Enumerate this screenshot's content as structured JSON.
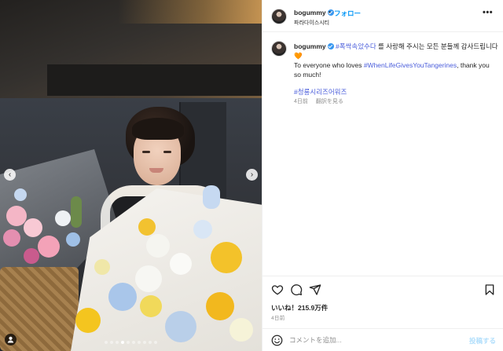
{
  "post": {
    "author": {
      "username": "bogummy",
      "verified": true,
      "location": "파라다이스시티",
      "follow_label": "フォロー",
      "separator": "•"
    },
    "caption": {
      "hashtag1": "#폭싹속았수다",
      "text_ko_after": " 를 사랑해 주시는 모든 분들께 감사드립니다",
      "heart_emoji": "🧡",
      "text_en_before": "To everyone who loves ",
      "hashtag2": "#WhenLifeGivesYouTangerines",
      "text_en_after": ", thank you so much!",
      "hashtag3": "#청룡시리즈어워즈"
    },
    "caption_meta": {
      "age": "4日前",
      "translate_label": "翻訳を見る"
    },
    "likes_text": "いいね！215.9万件",
    "date_text": "4日前",
    "carousel": {
      "total_slides": 10,
      "active_slide": 4
    }
  },
  "comment": {
    "placeholder": "コメントを追加...",
    "post_label": "投稿する"
  },
  "icons": {
    "more": "more-options-icon",
    "like": "heart-icon",
    "comment": "comment-icon",
    "share": "paper-plane-icon",
    "save": "bookmark-icon",
    "emoji": "smiley-icon",
    "prev": "chevron-left-icon",
    "next": "chevron-right-icon",
    "tags": "user-tag-icon"
  },
  "colors": {
    "link_blue": "#0095f6",
    "hashtag": "#4a5ddb",
    "verified": "#3897f0",
    "secondary_text": "#8e8e8e",
    "post_disabled": "#b2dffc"
  }
}
